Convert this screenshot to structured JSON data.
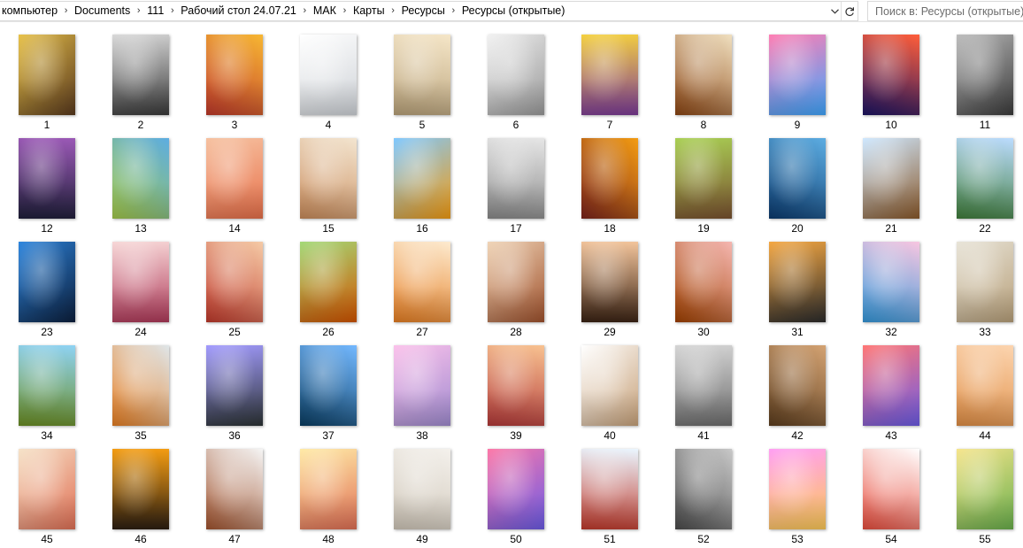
{
  "address_bar": {
    "breadcrumbs": [
      "компьютер",
      "Documents",
      "111",
      "Рабочий стол 24.07.21",
      "МАК",
      "Карты",
      "Ресурсы",
      "Ресурсы (открытые)"
    ],
    "dropdown_icon": "chevron-down-icon",
    "refresh_icon": "refresh-icon"
  },
  "search": {
    "placeholder": "Поиск в: Ресурсы (открытые)"
  },
  "items": [
    {
      "label": "1",
      "colors": [
        "#e8c24a",
        "#5a3a1e"
      ]
    },
    {
      "label": "2",
      "colors": [
        "#d9d9d9",
        "#3a3a3a"
      ]
    },
    {
      "label": "3",
      "colors": [
        "#f7b733",
        "#c0392b"
      ]
    },
    {
      "label": "4",
      "colors": [
        "#ffffff",
        "#cfd3d8"
      ]
    },
    {
      "label": "5",
      "colors": [
        "#f5e6c8",
        "#b9a27a"
      ]
    },
    {
      "label": "6",
      "colors": [
        "#f2f2f2",
        "#9a9a9a"
      ]
    },
    {
      "label": "7",
      "colors": [
        "#f4d03f",
        "#7d3c98"
      ]
    },
    {
      "label": "8",
      "colors": [
        "#f0e0c0",
        "#8b4513"
      ]
    },
    {
      "label": "9",
      "colors": [
        "#ff7eb3",
        "#3fa7ff"
      ]
    },
    {
      "label": "10",
      "colors": [
        "#ff5e3a",
        "#1b1464"
      ]
    },
    {
      "label": "11",
      "colors": [
        "#bdbdbd",
        "#3b3b3b"
      ]
    },
    {
      "label": "12",
      "colors": [
        "#9b59b6",
        "#1f1f3a"
      ]
    },
    {
      "label": "13",
      "colors": [
        "#5dade2",
        "#a3c94a"
      ]
    },
    {
      "label": "14",
      "colors": [
        "#f6c1a0",
        "#e8704a"
      ]
    },
    {
      "label": "15",
      "colors": [
        "#f3e5d0",
        "#c98b5a"
      ]
    },
    {
      "label": "16",
      "colors": [
        "#7fc8ff",
        "#f39c12"
      ]
    },
    {
      "label": "17",
      "colors": [
        "#e6e6e6",
        "#8a8a8a"
      ]
    },
    {
      "label": "18",
      "colors": [
        "#f39c12",
        "#7b241c"
      ]
    },
    {
      "label": "19",
      "colors": [
        "#a9cf54",
        "#7a5230"
      ]
    },
    {
      "label": "20",
      "colors": [
        "#5dade2",
        "#0b3a6e"
      ]
    },
    {
      "label": "21",
      "colors": [
        "#cfe8ff",
        "#8b5a2b"
      ]
    },
    {
      "label": "22",
      "colors": [
        "#bcdcff",
        "#3f7d3a"
      ]
    },
    {
      "label": "23",
      "colors": [
        "#2e86de",
        "#0c1f3d"
      ]
    },
    {
      "label": "24",
      "colors": [
        "#f7d7d7",
        "#b03a5a"
      ]
    },
    {
      "label": "25",
      "colors": [
        "#f5cba7",
        "#c0392b"
      ]
    },
    {
      "label": "26",
      "colors": [
        "#a3d977",
        "#d35400"
      ]
    },
    {
      "label": "27",
      "colors": [
        "#fdebd0",
        "#e67e22"
      ]
    },
    {
      "label": "28",
      "colors": [
        "#f0d5b8",
        "#a0522d"
      ]
    },
    {
      "label": "29",
      "colors": [
        "#f2c49b",
        "#3b2314"
      ]
    },
    {
      "label": "30",
      "colors": [
        "#f5b7b1",
        "#a04000"
      ]
    },
    {
      "label": "31",
      "colors": [
        "#f4a742",
        "#2c2c2c"
      ]
    },
    {
      "label": "32",
      "colors": [
        "#f8c6e0",
        "#3498db"
      ]
    },
    {
      "label": "33",
      "colors": [
        "#e8e4d8",
        "#b8a07a"
      ]
    },
    {
      "label": "34",
      "colors": [
        "#8fd3f4",
        "#6b8e23"
      ]
    },
    {
      "label": "35",
      "colors": [
        "#dfe6e9",
        "#e67e22"
      ]
    },
    {
      "label": "36",
      "colors": [
        "#a29bfe",
        "#2d3436"
      ]
    },
    {
      "label": "37",
      "colors": [
        "#74b9ff",
        "#0a3d62"
      ]
    },
    {
      "label": "38",
      "colors": [
        "#fbc2eb",
        "#a18cd1"
      ]
    },
    {
      "label": "39",
      "colors": [
        "#f8c291",
        "#b33939"
      ]
    },
    {
      "label": "40",
      "colors": [
        "#ffffff",
        "#c8a27a"
      ]
    },
    {
      "label": "41",
      "colors": [
        "#d5d5d5",
        "#6e6e6e"
      ]
    },
    {
      "label": "42",
      "colors": [
        "#d4a373",
        "#5c3d1e"
      ]
    },
    {
      "label": "43",
      "colors": [
        "#ff7675",
        "#6c5ce7"
      ]
    },
    {
      "label": "44",
      "colors": [
        "#fcd5b0",
        "#e08e45"
      ]
    },
    {
      "label": "45",
      "colors": [
        "#f6e3c9",
        "#e17055"
      ]
    },
    {
      "label": "46",
      "colors": [
        "#f39c12",
        "#2d1f12"
      ]
    },
    {
      "label": "47",
      "colors": [
        "#f5f5f5",
        "#a0522d"
      ]
    },
    {
      "label": "48",
      "colors": [
        "#ffeaa7",
        "#e17055"
      ]
    },
    {
      "label": "49",
      "colors": [
        "#f4f1ec",
        "#cfc6b8"
      ]
    },
    {
      "label": "50",
      "colors": [
        "#fd79a8",
        "#6c5ce7"
      ]
    },
    {
      "label": "51",
      "colors": [
        "#eaf6ff",
        "#c0392b"
      ]
    },
    {
      "label": "52",
      "colors": [
        "#c8c8c8",
        "#4a4a4a"
      ]
    },
    {
      "label": "53",
      "colors": [
        "#ff9ff3",
        "#feca57"
      ]
    },
    {
      "label": "54",
      "colors": [
        "#ffffff",
        "#e74c3c"
      ]
    },
    {
      "label": "55",
      "colors": [
        "#f6e58d",
        "#6ab04c"
      ]
    }
  ]
}
